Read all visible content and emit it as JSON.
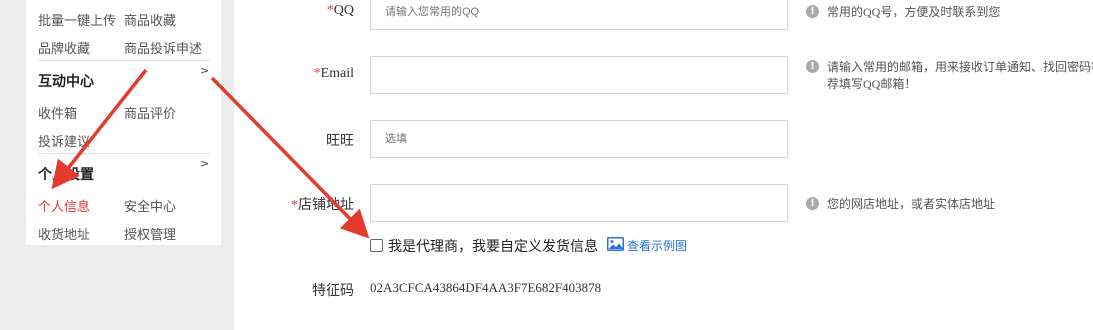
{
  "sidebar": {
    "row1": {
      "left": "批量一键上传",
      "right": "商品收藏"
    },
    "row2": {
      "left": "品牌收藏",
      "right": "商品投诉申述"
    },
    "interaction": {
      "title": "互动中心",
      "arrow": ">",
      "row1": {
        "left": "收件箱",
        "right": "商品评价"
      },
      "row2": {
        "left": "投诉建议"
      }
    },
    "personal": {
      "title": "个人设置",
      "arrow": ">",
      "row1": {
        "left": "个人信息",
        "right": "安全中心"
      },
      "row2": {
        "left": "收货地址",
        "right": "授权管理"
      }
    }
  },
  "form": {
    "required_mark": "*",
    "qq": {
      "label": "QQ",
      "placeholder": "请输入您常用的QQ",
      "hint": "常用的QQ号，方便及时联系到您"
    },
    "email": {
      "label": "Email",
      "value": "",
      "hint_line1": "请输入常用的邮箱，用来接收订单通知、找回密码等",
      "hint_line2": "荐填写QQ邮箱！"
    },
    "wangwang": {
      "label": "旺旺",
      "placeholder": "选填"
    },
    "shop_address": {
      "label": "店铺地址",
      "value": "",
      "hint": "您的网店地址，或者实体店地址"
    },
    "agent": {
      "checked": false,
      "label": "我是代理商，我要自定义发货信息",
      "example_link": "查看示例图"
    },
    "fingerprint": {
      "label": "特征码",
      "value": "02A3CFCA43864DF4AA3F7E682F403878"
    }
  },
  "icons": {
    "hint": "info-icon",
    "example": "image-icon"
  },
  "colors": {
    "accent_red": "#e4393c",
    "link_blue": "#2b73d0",
    "arrow_red": "#e53a2e"
  }
}
